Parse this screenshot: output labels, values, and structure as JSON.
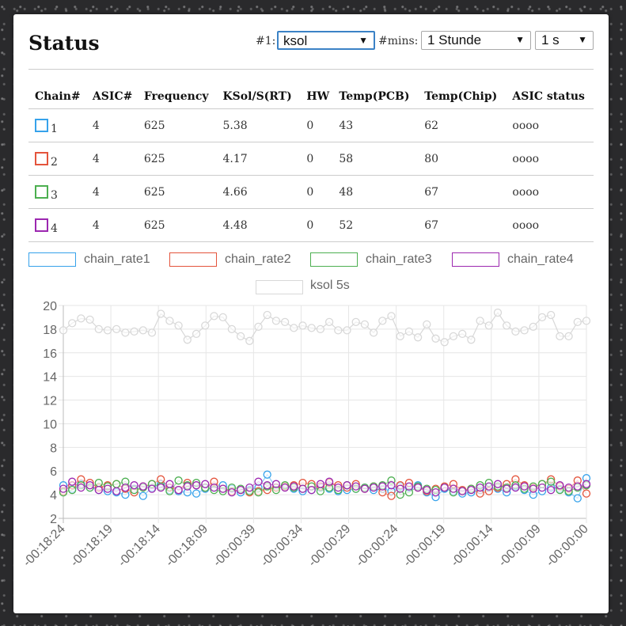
{
  "header": {
    "title": "Status",
    "chain_label": "#1:",
    "chain_select": "ksol",
    "mins_label": "#mins:",
    "mins_select": "1 Stunde",
    "interval_select": "1 s"
  },
  "table": {
    "columns": [
      "Chain#",
      "ASIC#",
      "Frequency",
      "KSol/S(RT)",
      "HW",
      "Temp(PCB)",
      "Temp(Chip)",
      "ASIC status"
    ],
    "rows": [
      {
        "chain": "1",
        "color": "#36a2eb",
        "asic": "4",
        "freq": "625",
        "ksol": "5.38",
        "hw": "0",
        "pcb": "43",
        "chip": "62",
        "status": "oooo"
      },
      {
        "chain": "2",
        "color": "#e4543c",
        "asic": "4",
        "freq": "625",
        "ksol": "4.17",
        "hw": "0",
        "pcb": "58",
        "chip": "80",
        "status": "oooo"
      },
      {
        "chain": "3",
        "color": "#4caf50",
        "asic": "4",
        "freq": "625",
        "ksol": "4.66",
        "hw": "0",
        "pcb": "48",
        "chip": "67",
        "status": "oooo"
      },
      {
        "chain": "4",
        "color": "#9c27b0",
        "asic": "4",
        "freq": "625",
        "ksol": "4.48",
        "hw": "0",
        "pcb": "52",
        "chip": "67",
        "status": "oooo"
      }
    ]
  },
  "chart_data": {
    "type": "line",
    "ylim": [
      2,
      20
    ],
    "y_ticks": [
      "20",
      "18",
      "16",
      "14",
      "12",
      "10",
      "8",
      "6",
      "4",
      "2"
    ],
    "x_tick_labels": [
      "-00:18:24",
      "-00:18:19",
      "-00:18:14",
      "-00:18:09",
      "-00:00:39",
      "-00:00:34",
      "-00:00:29",
      "-00:00:24",
      "-00:00:19",
      "-00:00:14",
      "-00:00:09",
      "-00:00:00"
    ],
    "grid": true,
    "legend_position": "top",
    "series": [
      {
        "name": "chain_rate1",
        "color": "#36a2eb",
        "values": [
          4.8,
          4.5,
          4.9,
          4.6,
          4.4,
          4.3,
          4.2,
          4.0,
          4.5,
          3.9,
          4.6,
          4.9,
          4.4,
          4.3,
          4.2,
          4.1,
          4.5,
          4.6,
          4.8,
          4.5,
          4.2,
          4.4,
          4.6,
          5.7,
          4.6,
          4.7,
          4.5,
          4.3,
          4.4,
          4.6,
          4.5,
          4.3,
          4.4,
          4.5,
          4.6,
          4.4,
          4.5,
          4.3,
          4.7,
          4.6,
          4.8,
          4.2,
          3.8,
          4.5,
          4.3,
          4.1,
          4.2,
          4.4,
          4.6,
          4.5,
          4.2,
          4.7,
          4.4,
          4.0,
          4.3,
          4.6,
          4.5,
          4.2,
          3.7,
          5.4
        ]
      },
      {
        "name": "chain_rate2",
        "color": "#e4543c",
        "values": [
          4.3,
          4.8,
          5.3,
          5.0,
          4.6,
          4.8,
          4.9,
          4.5,
          4.2,
          4.7,
          4.9,
          5.3,
          4.6,
          4.4,
          5.0,
          4.8,
          4.6,
          5.1,
          4.5,
          4.3,
          4.4,
          4.2,
          4.3,
          4.4,
          4.6,
          4.7,
          4.8,
          5.0,
          4.9,
          4.7,
          5.0,
          4.8,
          4.6,
          4.9,
          4.5,
          4.7,
          4.2,
          3.9,
          4.8,
          5.0,
          4.6,
          4.3,
          4.5,
          4.7,
          4.9,
          4.4,
          4.5,
          4.1,
          4.3,
          4.6,
          4.9,
          5.3,
          4.8,
          4.6,
          4.9,
          5.3,
          4.7,
          4.5,
          5.2,
          4.1
        ]
      },
      {
        "name": "chain_rate3",
        "color": "#4caf50",
        "values": [
          4.2,
          4.4,
          4.8,
          4.6,
          5.0,
          4.7,
          4.9,
          5.1,
          4.4,
          4.6,
          4.9,
          4.7,
          4.3,
          5.2,
          4.8,
          5.0,
          4.6,
          4.4,
          4.3,
          4.6,
          4.5,
          4.3,
          4.2,
          4.7,
          4.4,
          4.8,
          4.6,
          4.5,
          4.7,
          4.3,
          4.6,
          4.4,
          4.8,
          4.5,
          4.6,
          4.7,
          4.8,
          5.2,
          4.0,
          4.2,
          4.7,
          4.5,
          4.4,
          4.6,
          4.2,
          4.3,
          4.5,
          4.8,
          5.0,
          4.7,
          4.6,
          4.8,
          4.5,
          4.7,
          4.9,
          5.1,
          4.4,
          4.3,
          4.6,
          4.8
        ]
      },
      {
        "name": "chain_rate4",
        "color": "#9c27b0",
        "values": [
          4.5,
          5.1,
          4.6,
          4.8,
          4.4,
          4.5,
          4.3,
          4.6,
          4.8,
          4.7,
          4.5,
          4.6,
          4.9,
          4.4,
          4.7,
          4.8,
          4.9,
          4.6,
          4.5,
          4.2,
          4.4,
          4.6,
          5.1,
          4.8,
          4.9,
          4.6,
          4.7,
          4.5,
          4.4,
          4.9,
          5.1,
          4.6,
          4.8,
          4.7,
          4.5,
          4.6,
          4.7,
          4.8,
          4.5,
          4.7,
          4.6,
          4.4,
          4.2,
          4.6,
          4.5,
          4.3,
          4.4,
          4.6,
          4.7,
          4.9,
          4.5,
          4.6,
          4.7,
          4.5,
          4.6,
          4.4,
          4.8,
          4.6,
          4.7,
          4.9
        ]
      },
      {
        "name": "ksol 5s",
        "color": "#d8d8d8",
        "values": [
          17.9,
          18.5,
          18.9,
          18.8,
          18.0,
          17.9,
          18.0,
          17.7,
          17.8,
          17.9,
          17.7,
          19.3,
          18.7,
          18.3,
          17.1,
          17.6,
          18.3,
          19.1,
          19.0,
          18.0,
          17.4,
          17.0,
          18.2,
          19.2,
          18.7,
          18.6,
          18.1,
          18.3,
          18.1,
          18.0,
          18.6,
          17.9,
          17.9,
          18.6,
          18.4,
          17.7,
          18.7,
          19.1,
          17.4,
          17.8,
          17.3,
          18.4,
          17.2,
          16.9,
          17.4,
          17.6,
          17.1,
          18.7,
          18.3,
          19.4,
          18.3,
          17.8,
          17.9,
          18.2,
          19.0,
          19.2,
          17.4,
          17.4,
          18.6,
          18.7
        ]
      }
    ]
  }
}
